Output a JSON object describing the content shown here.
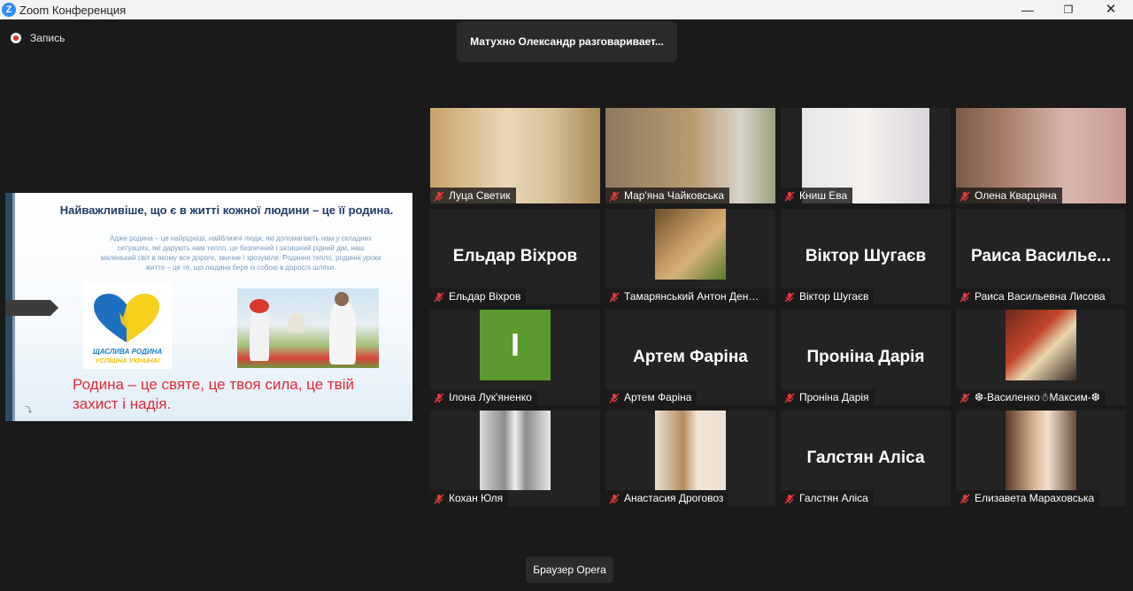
{
  "window": {
    "app_name": "Zoom Конференция",
    "logo": "Z",
    "minimize_glyph": "—",
    "maximize_glyph": "❐",
    "close_glyph": "✕"
  },
  "recording": {
    "label": "Запись"
  },
  "banner": {
    "talking": "Матухно Олександр разговаривает..."
  },
  "slide": {
    "title": "Найважливіше, що є в житті кожної людини – це її родина.",
    "body": "Адже родина – це найрідніші, найближчі люди, які допомагають нам у складних ситуаціях, які дарують нам тепло, це безпечний і затишний рідний дім, наш маленький світ в якому все дороге, звичне і зрозуміле. Родинне тепло, родинні уроки життя – це те, що людина бере із собою в дорослі шляхи.",
    "logo_line1": "ЩАСЛИВА РОДИНА",
    "logo_line2": "УСПІШНА УКРАЇНА!",
    "caption": "Родина – це святе, це твоя сила, це твій захист і надія.",
    "corner_mark": "⤵"
  },
  "participants": [
    {
      "label": "Луца Светик"
    },
    {
      "label": "Мар'яна Чайковська"
    },
    {
      "label": "Книш Ева"
    },
    {
      "label": "Олена Кварцяна"
    },
    {
      "label": "Ельдар Віхров",
      "display_name": "Ельдар Віхров"
    },
    {
      "label": "Тамарянський Антон Дени..."
    },
    {
      "label": "Віктор Шугаєв",
      "display_name": "Віктор Шугаєв"
    },
    {
      "label": "Раиса Васильевна Лисова",
      "display_name": "Раиса  Василье..."
    },
    {
      "label": "Ілона Лук'яненко",
      "avatar_initial": "І",
      "avatar_color": "#5b9a2e"
    },
    {
      "label": "Артем Фаріна",
      "display_name": "Артем Фаріна"
    },
    {
      "label": "Проніна Дарія",
      "display_name": "Проніна Дарія"
    },
    {
      "label": "❆-Василенко☃Максим-❆"
    },
    {
      "label": "Кохан Юля"
    },
    {
      "label": "Анастасия Дроговоз"
    },
    {
      "label": "Галстян Аліса",
      "display_name": "Галстян Аліса"
    },
    {
      "label": "Елизавета Мараховська"
    }
  ],
  "tooltip": {
    "text": "Браузер Opera"
  },
  "colors": {
    "mute": "#e8383d",
    "accent": "#2d8cff",
    "record": "#e0312c"
  },
  "icons": [
    "zoom-logo-icon",
    "record-icon",
    "mic-muted-icon",
    "minimize-icon",
    "maximize-icon",
    "close-icon"
  ]
}
